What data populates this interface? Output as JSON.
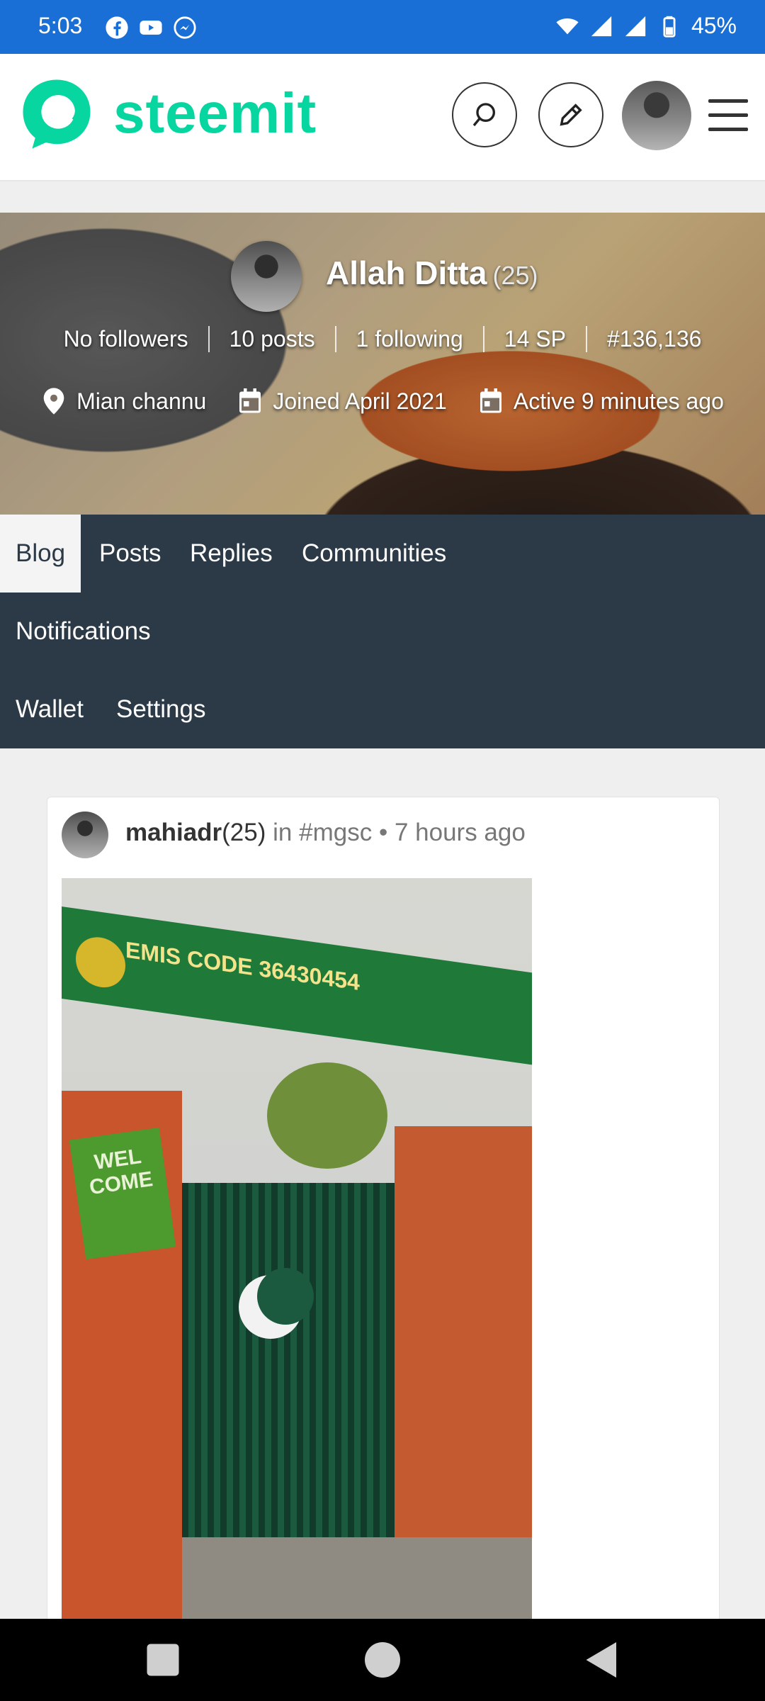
{
  "status_bar": {
    "time": "5:03",
    "battery": "45%"
  },
  "header": {
    "logo_text": "steemit",
    "brand_color": "#07d6a0"
  },
  "profile": {
    "name": "Allah Ditta",
    "reputation": "(25)",
    "stats": [
      "No followers",
      "10 posts",
      "1 following",
      "14 SP",
      "#136,136"
    ],
    "location": "Mian channu",
    "joined": "Joined April 2021",
    "active": "Active 9 minutes ago"
  },
  "tabs": {
    "blog": "Blog",
    "posts": "Posts",
    "replies": "Replies",
    "communities": "Communities",
    "notifications": "Notifications",
    "wallet": "Wallet",
    "settings": "Settings",
    "active": "Blog"
  },
  "post": {
    "author": "mahiadr",
    "reputation": "(25)",
    "in_text": "in",
    "tag": "#mgsc",
    "separator": "•",
    "time": "7 hours ago"
  },
  "photo": {
    "sign_text": "EMIS CODE 36430454",
    "welcome_text": "WEL COME"
  }
}
